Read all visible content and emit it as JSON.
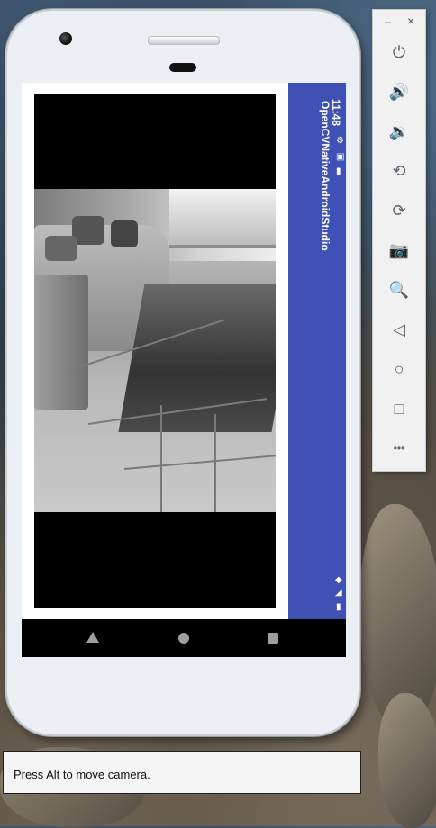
{
  "app": {
    "title": "OpenCVNativeAndroidStudio",
    "status_time": "11:48",
    "accent_color": "#3f51b5"
  },
  "status_icons": [
    "gear-icon",
    "image-icon",
    "sd-card-icon",
    "wifi-icon",
    "signal-icon",
    "battery-icon"
  ],
  "navbar": {
    "buttons": [
      "back-icon",
      "home-icon",
      "recents-icon"
    ]
  },
  "emulator_toolbar": {
    "minimize_label": "–",
    "close_label": "×",
    "buttons": [
      {
        "name": "power-button",
        "icon": "⏻"
      },
      {
        "name": "volume-up-button",
        "icon": "🔊"
      },
      {
        "name": "volume-down-button",
        "icon": "🔉"
      },
      {
        "name": "rotate-left-button",
        "icon": "⟲"
      },
      {
        "name": "rotate-right-button",
        "icon": "⟳"
      },
      {
        "name": "screenshot-button",
        "icon": "📷"
      },
      {
        "name": "zoom-button",
        "icon": "🔍"
      },
      {
        "name": "back-button",
        "icon": "◁"
      },
      {
        "name": "home-button",
        "icon": "○"
      },
      {
        "name": "overview-button",
        "icon": "□"
      },
      {
        "name": "more-button",
        "icon": "•••"
      }
    ]
  },
  "tooltip": {
    "text": "Press Alt to move camera."
  }
}
